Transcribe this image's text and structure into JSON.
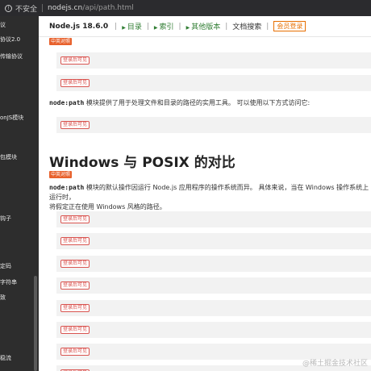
{
  "browser": {
    "security_label": "不安全",
    "url_host": "nodejs.cn",
    "url_path": "/api/path.html"
  },
  "sidebar": {
    "items": [
      "议",
      "协议2.0",
      "传输协议",
      "onJS模块",
      "包模块",
      "钩子",
      "定码",
      "字符串",
      "致",
      "稳流"
    ]
  },
  "header": {
    "title": "Node.js 18.6.0",
    "links": [
      "目录",
      "索引",
      "其他版本"
    ],
    "docs_search": "文档搜索",
    "member_login": "会员登录"
  },
  "content": {
    "tag_label": "中英对照",
    "login_badge": "登录后可见",
    "intro_code": "node:path",
    "intro_text": " 模块提供了用于处理文件和目录的路径的实用工具。 可以使用以下方式访问它:",
    "section_title": "Windows 与 POSIX 的对比",
    "section_code": "node:path",
    "section_text": " 模块的默认操作因运行 Node.js 应用程序的操作系统而异。 具体来说，当在 Windows 操作系统上运行时，",
    "section_text2": "将假定正在使用 Windows 风格的路径。"
  },
  "watermark": "@稀土掘金技术社区"
}
